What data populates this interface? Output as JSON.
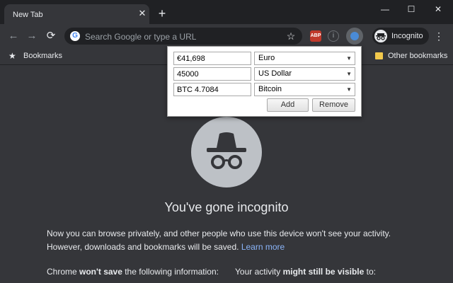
{
  "tab": {
    "title": "New Tab",
    "close_glyph": "✕",
    "new_tab_glyph": "+"
  },
  "window": {
    "minimize_glyph": "—",
    "maximize_glyph": "☐",
    "close_glyph": "✕"
  },
  "toolbar": {
    "back_glyph": "←",
    "forward_glyph": "→",
    "reload_glyph": "⟳",
    "omnibox_placeholder": "Search Google or type a URL",
    "star_glyph": "☆",
    "abp_label": "ABP",
    "info_glyph": "i",
    "profile_label": "Incognito",
    "menu_glyph": "⋮"
  },
  "bookmarks_bar": {
    "star_glyph": "★",
    "bookmarks_label": "Bookmarks",
    "other_bookmarks": "Other bookmarks"
  },
  "converter": {
    "rows": [
      {
        "amount": "€41,698",
        "currency": "Euro"
      },
      {
        "amount": "45000",
        "currency": "US Dollar"
      },
      {
        "amount": "BTC 4.7084",
        "currency": "Bitcoin"
      }
    ],
    "caret_glyph": "▼",
    "add_label": "Add",
    "remove_label": "Remove"
  },
  "incognito": {
    "headline": "You've gone incognito",
    "paragraph_line1": "Now you can browse privately, and other people who use this device won't see your activity.",
    "paragraph_line2": "However, downloads and bookmarks will be saved.",
    "learn_more": "Learn more",
    "left_col": {
      "prefix": "Chrome ",
      "bold": "won't save",
      "suffix": " the following information:"
    },
    "right_col": {
      "prefix": "Your activity ",
      "bold": "might still be visible",
      "suffix": " to:"
    }
  },
  "colors": {
    "frame": "#202124",
    "toolbar": "#35363a",
    "text": "#e8eaed",
    "link": "#8ab4f8",
    "abp_red": "#c0392b"
  },
  "icons": [
    "back-icon",
    "forward-icon",
    "reload-icon",
    "google-icon",
    "star-icon",
    "abp-icon",
    "info-icon",
    "currency-converter-icon",
    "incognito-icon",
    "menu-icon",
    "folder-icon"
  ]
}
